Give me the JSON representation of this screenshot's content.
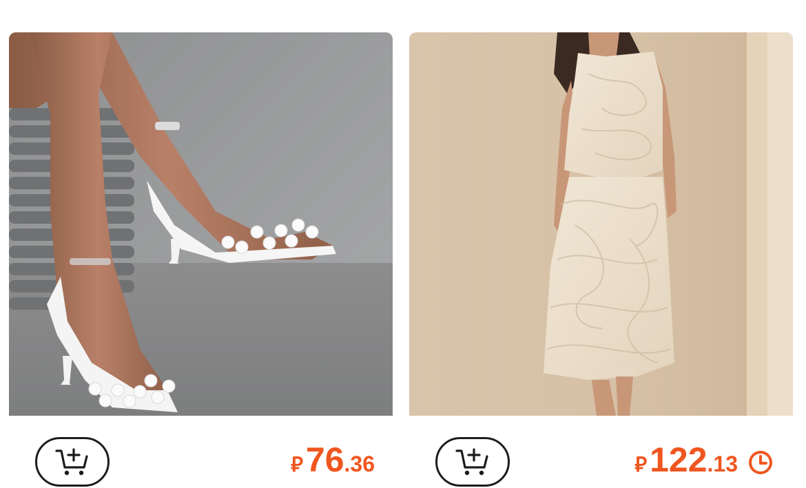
{
  "products": [
    {
      "image_alt": "White pearl-studded clear strap stiletto sandals",
      "cart_icon": "add-to-cart-icon",
      "currency_symbol": "⃁",
      "price_int": "76",
      "price_dec": ".36"
    },
    {
      "image_alt": "Cream textured sleeveless top and midi skirt set",
      "cart_icon": "add-to-cart-icon",
      "currency_symbol": "⃁",
      "price_int": "122",
      "price_dec": ".13",
      "badge_icon": "clock-icon"
    }
  ],
  "colors": {
    "price": "#f0561f",
    "border": "#1c1c1c"
  }
}
